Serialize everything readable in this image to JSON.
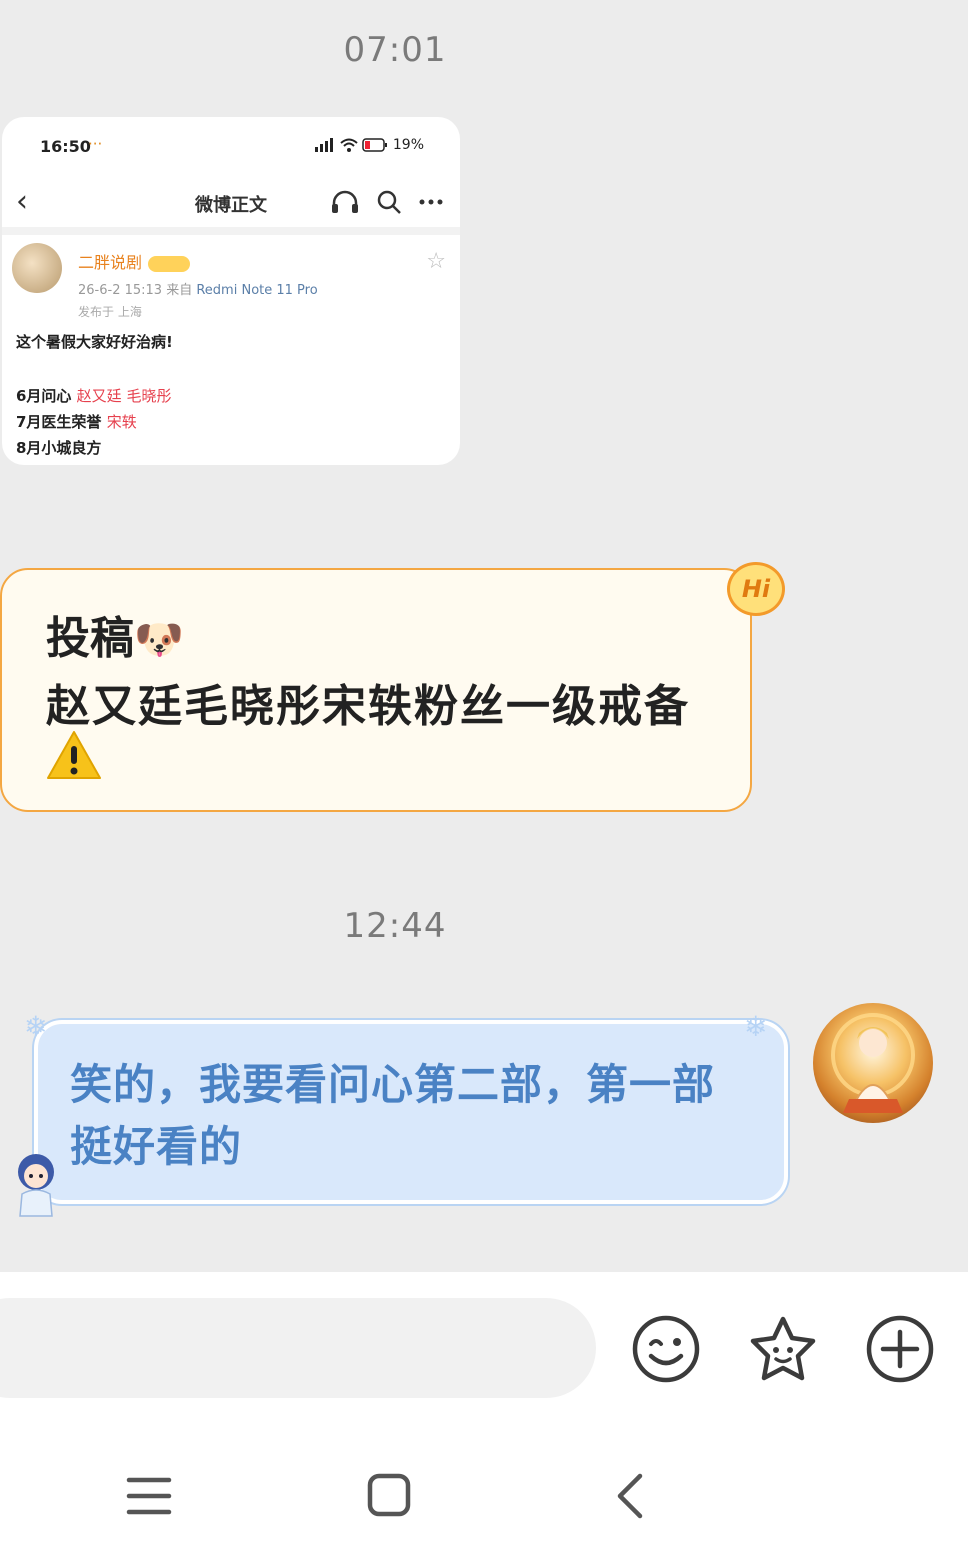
{
  "timestamps": [
    "07:01",
    "12:44"
  ],
  "shared_screenshot": {
    "status_time": "16:50",
    "status_dots": "···",
    "battery": "19%",
    "title": "微博正文",
    "user_name": "二胖说剧",
    "post_date": "26-6-2 15:13",
    "post_source_prefix": "来自",
    "post_device": "Redmi Note 11 Pro",
    "post_location": "发布于 上海",
    "post_text": "这个暑假大家好好治病!",
    "lines": [
      {
        "label": "6月问心",
        "names": "赵又廷 毛晓彤"
      },
      {
        "label": "7月医生荣誉",
        "names": "宋轶"
      },
      {
        "label": "8月小城良方",
        "names": ""
      }
    ]
  },
  "message_1": {
    "line1": "投稿",
    "line2": "赵又廷毛晓彤宋轶粉丝一级戒备",
    "emoji_dog": "🐶",
    "emoji_warning": "⚠️",
    "badge": "Hi"
  },
  "message_2": {
    "text": "笑的，我要看问心第二部，第一部挺好看的"
  },
  "icons": {
    "emoji": "emoji-icon",
    "favorite": "sticker-icon",
    "add": "add-icon",
    "menu": "menu-icon",
    "home": "home-icon",
    "back": "back-icon"
  },
  "colors": {
    "orange_border": "#f4a742",
    "blue_bubble": "#d9e8fb",
    "blue_text": "#4a82c4",
    "red_names": "#e6414e"
  }
}
